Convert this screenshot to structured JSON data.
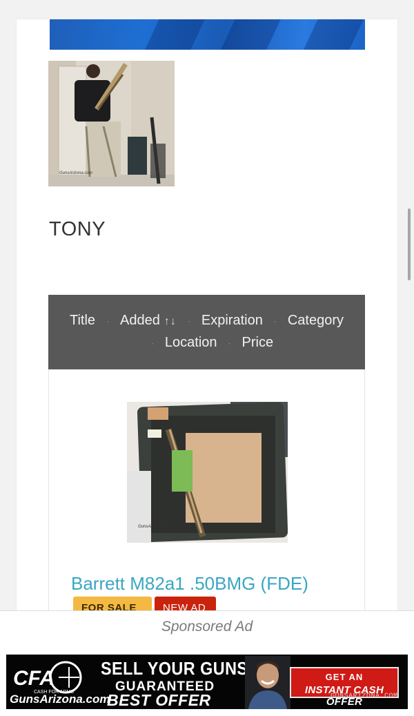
{
  "profile": {
    "name": "TONY",
    "photo_watermark": "GunsArizona.com"
  },
  "sort_bar": {
    "row1": [
      "Title",
      "Added",
      "Expiration",
      "Category"
    ],
    "row2": [
      "Location",
      "Price"
    ],
    "separator": "·",
    "active_sort_arrows": "↑↓"
  },
  "listing": {
    "title": "Barrett M82a1 .50BMG (FDE)",
    "badges": {
      "for_sale": "FOR SALE",
      "new_ad": "NEW AD"
    },
    "photo_watermark": "GunsArizona.com"
  },
  "ad": {
    "label": "Sponsored Ad",
    "logo_text": "GunsArizona.com",
    "logo_small": "CASH FOR ARMS",
    "line1": "SELL YOUR GUNS",
    "line2": "GUARANTEED",
    "line3": "BEST OFFER",
    "cta_line1": "GET AN",
    "cta_line2": "INSTANT CASH OFFER",
    "url": "GUNSARIZONA.COM"
  },
  "colors": {
    "sort_bar_bg": "#585858",
    "title_link": "#3aa6c2",
    "badge_sale": "#f4b942",
    "badge_new": "#c9230e",
    "ad_cta": "#d01a16"
  }
}
